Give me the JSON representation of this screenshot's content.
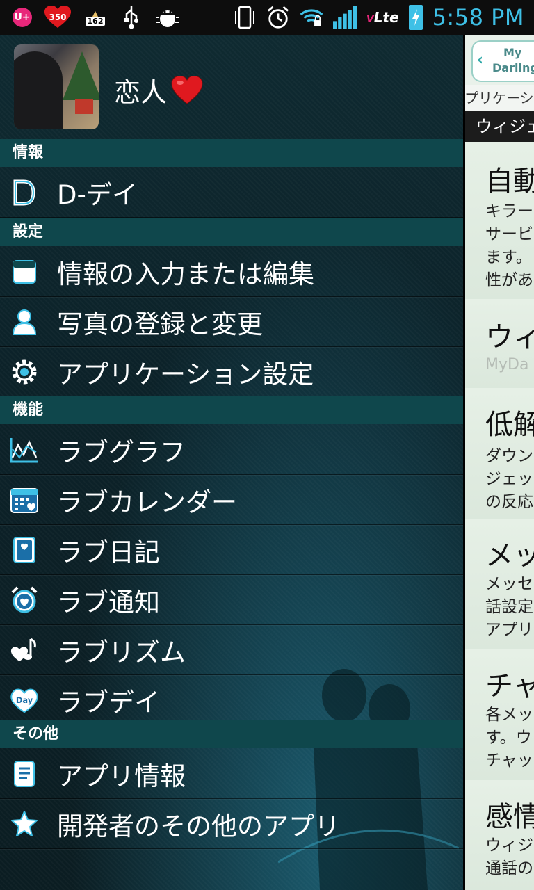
{
  "status_bar": {
    "badge_count": "350",
    "cake_number": "162",
    "network": "Lte",
    "network_prefix": "V",
    "time": "5:58 PM"
  },
  "profile": {
    "name": "恋人"
  },
  "sections": {
    "info": "情報",
    "settings": "設定",
    "features": "機能",
    "other": "その他"
  },
  "menu": {
    "dday": "D-デイ",
    "edit_info": "情報の入力または編集",
    "photo": "写真の登録と変更",
    "app_settings": "アプリケーション設定",
    "love_graph": "ラブグラフ",
    "love_calendar": "ラブカレンダー",
    "love_diary": "ラブ日記",
    "love_notify": "ラブ通知",
    "love_rhythm": "ラブリズム",
    "love_day": "ラブデイ",
    "app_info": "アプリ情報",
    "other_apps": "開発者のその他のアプリ"
  },
  "panel": {
    "logo_line1": "My",
    "logo_line2": "Darling",
    "breadcrumb": "プリケーシ",
    "tab": "ウィジェ",
    "sections": [
      {
        "title": "自動",
        "body": "キラー\nサービ\nます。\n性があ"
      },
      {
        "title": "ウィ",
        "gray": "MyDa"
      },
      {
        "title": "低解",
        "body": "ダウン\nジェッ\nの反応"
      },
      {
        "title": "メッ",
        "body": "メッセ\n話設定\nアプリ"
      },
      {
        "title": "チャ",
        "body": "各メッ\nす。ウ\nチャッ"
      },
      {
        "title": "感情",
        "body": "ウィジ\n通話の"
      }
    ]
  },
  "colors": {
    "section_bg": "#0f474c",
    "accent": "#3ec0e6",
    "heart": "#e0191f"
  }
}
